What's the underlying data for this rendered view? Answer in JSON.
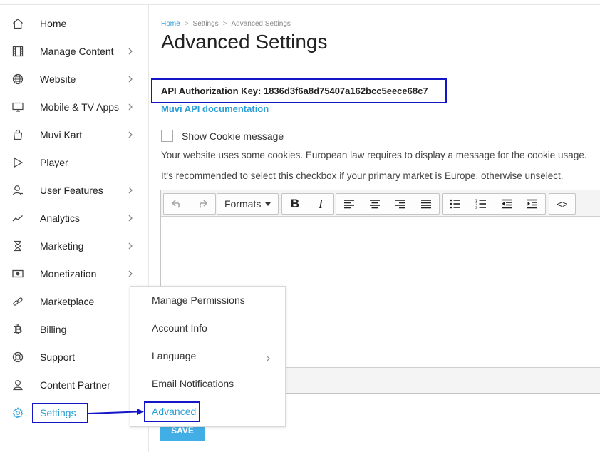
{
  "sidebar": {
    "items": [
      {
        "label": "Home",
        "icon": "home-icon"
      },
      {
        "label": "Manage Content",
        "icon": "film-icon"
      },
      {
        "label": "Website",
        "icon": "globe-icon"
      },
      {
        "label": "Mobile & TV Apps",
        "icon": "monitor-icon"
      },
      {
        "label": "Muvi Kart",
        "icon": "shopping-bag-icon"
      },
      {
        "label": "Player",
        "icon": "play-icon"
      },
      {
        "label": "User Features",
        "icon": "user-icon"
      },
      {
        "label": "Analytics",
        "icon": "trend-icon"
      },
      {
        "label": "Marketing",
        "icon": "hourglass-icon"
      },
      {
        "label": "Monetization",
        "icon": "money-icon"
      },
      {
        "label": "Marketplace",
        "icon": "link-icon"
      },
      {
        "label": "Billing",
        "icon": "bitcoin-icon"
      },
      {
        "label": "Support",
        "icon": "lifebuoy-icon"
      },
      {
        "label": "Content Partner",
        "icon": "partner-icon"
      },
      {
        "label": "Settings",
        "icon": "gear-icon"
      }
    ]
  },
  "breadcrumb": {
    "home": "Home",
    "separator": ">",
    "settings": "Settings",
    "current": "Advanced Settings"
  },
  "page": {
    "title": "Advanced Settings",
    "api_key": "API Authorization Key: 1836d3f6a8d75407a162bcc5eece68c7",
    "api_doc_link": "Muvi API documentation",
    "cookie_label": "Show Cookie message",
    "cookie_checked": false,
    "desc_line1": "Your website uses some cookies. European law requires to display a message for the cookie usage.",
    "desc_line2": "It's recommended to select this checkbox if your primary market is Europe, otherwise unselect.",
    "save_label": "SAVE"
  },
  "editor": {
    "formats_label": "Formats",
    "bold": "B",
    "italic": "I",
    "code": "<>"
  },
  "flyout": {
    "items": [
      "Manage Permissions",
      "Account Info",
      "Language",
      "Email Notifications",
      "Advanced"
    ]
  },
  "colors": {
    "accent": "#2a9fd6",
    "highlight_box": "#1515c8",
    "save_button": "#42aee6"
  }
}
